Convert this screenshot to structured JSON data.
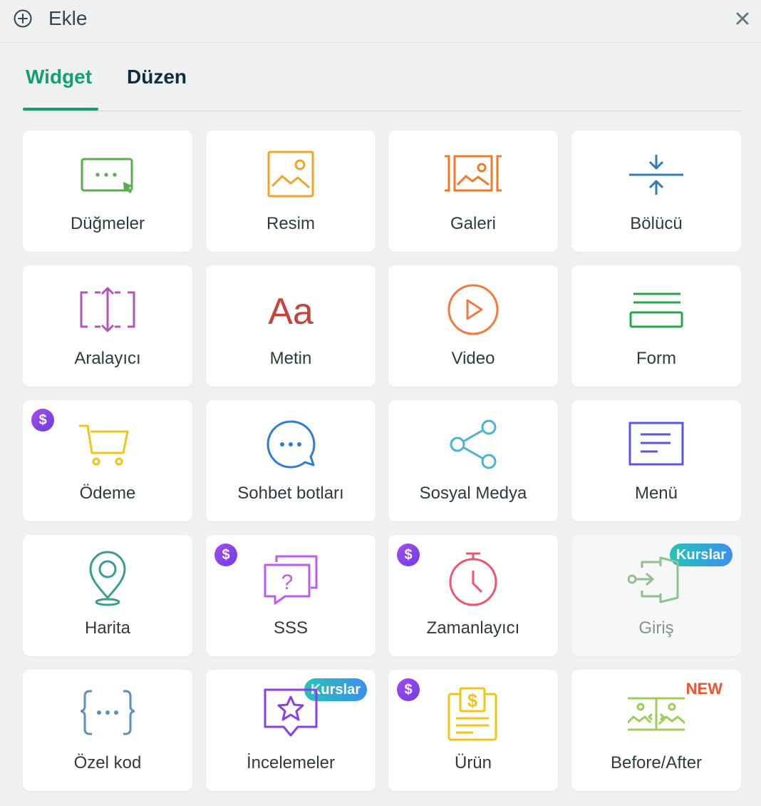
{
  "header": {
    "title": "Ekle"
  },
  "tabs": [
    {
      "label": "Widget",
      "active": true
    },
    {
      "label": "Düzen",
      "active": false
    }
  ],
  "colors": {
    "accent": "#13a06b",
    "tab_inactive": "#0f2e3c",
    "premium": "#7b40e6",
    "new": "#ef5534"
  },
  "widgets": [
    {
      "label": "Düğmeler",
      "icon": "button-icon"
    },
    {
      "label": "Resim",
      "icon": "image-icon"
    },
    {
      "label": "Galeri",
      "icon": "gallery-icon"
    },
    {
      "label": "Bölücü",
      "icon": "divider-icon"
    },
    {
      "label": "Aralayıcı",
      "icon": "spacer-icon"
    },
    {
      "label": "Metin",
      "icon": "text-icon",
      "icon_text": "Aa"
    },
    {
      "label": "Video",
      "icon": "video-icon"
    },
    {
      "label": "Form",
      "icon": "form-icon"
    },
    {
      "label": "Ödeme",
      "icon": "cart-icon",
      "premium": true,
      "premium_symbol": "$"
    },
    {
      "label": "Sohbet botları",
      "icon": "chat-bubble-icon"
    },
    {
      "label": "Sosyal Medya",
      "icon": "share-icon"
    },
    {
      "label": "Menü",
      "icon": "menu-icon"
    },
    {
      "label": "Harita",
      "icon": "map-pin-icon"
    },
    {
      "label": "SSS",
      "icon": "faq-icon",
      "premium": true,
      "premium_symbol": "$",
      "icon_text": "?"
    },
    {
      "label": "Zamanlayıcı",
      "icon": "timer-icon",
      "premium": true,
      "premium_symbol": "$"
    },
    {
      "label": "Giriş",
      "icon": "login-icon",
      "badge": "Kurslar",
      "disabled": true
    },
    {
      "label": "Özel kod",
      "icon": "code-icon"
    },
    {
      "label": "İncelemeler",
      "icon": "review-star-icon",
      "badge": "Kurslar"
    },
    {
      "label": "Ürün",
      "icon": "product-icon",
      "premium": true,
      "premium_symbol": "$",
      "icon_text": "$"
    },
    {
      "label": "Before/After",
      "icon": "before-after-icon",
      "new_badge": "NEW"
    }
  ]
}
